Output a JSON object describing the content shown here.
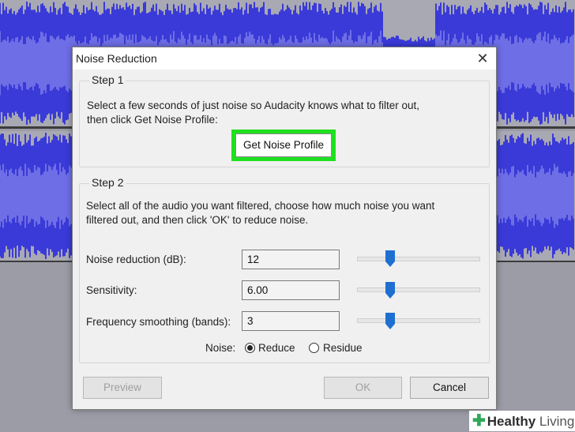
{
  "dialog": {
    "title": "Noise Reduction",
    "close_glyph": "✕"
  },
  "step1": {
    "legend": "Step 1",
    "desc_line1": "Select a few seconds of just noise so Audacity knows what to filter out,",
    "desc_line2": "then click Get Noise Profile:",
    "get_noise_profile_label": "Get Noise Profile"
  },
  "step2": {
    "legend": "Step 2",
    "desc_line1": "Select all of the audio you want filtered, choose how much noise you want",
    "desc_line2": "filtered out, and then click 'OK' to reduce noise.",
    "rows": [
      {
        "label": "Noise reduction (dB):",
        "value": "12",
        "slider_fraction": 0.27
      },
      {
        "label": "Sensitivity:",
        "value": "6.00",
        "slider_fraction": 0.27
      },
      {
        "label": "Frequency smoothing (bands):",
        "value": "3",
        "slider_fraction": 0.27
      }
    ],
    "noise_label": "Noise:",
    "radio_reduce": "Reduce",
    "radio_residue": "Residue",
    "selected_noise_option": "Reduce"
  },
  "buttons": {
    "preview": "Preview",
    "ok": "OK",
    "cancel": "Cancel"
  },
  "watermark": {
    "brand": "Healthy",
    "brand_suffix": "Living"
  },
  "colors": {
    "waveform": "#3a3ad8",
    "waveform_light": "#6e6ee6",
    "highlight": "#1fe01f",
    "slider_thumb": "#1f6fd1"
  },
  "icons": {
    "close": "close-icon",
    "watermark_logo": "plus-cross-icon"
  }
}
